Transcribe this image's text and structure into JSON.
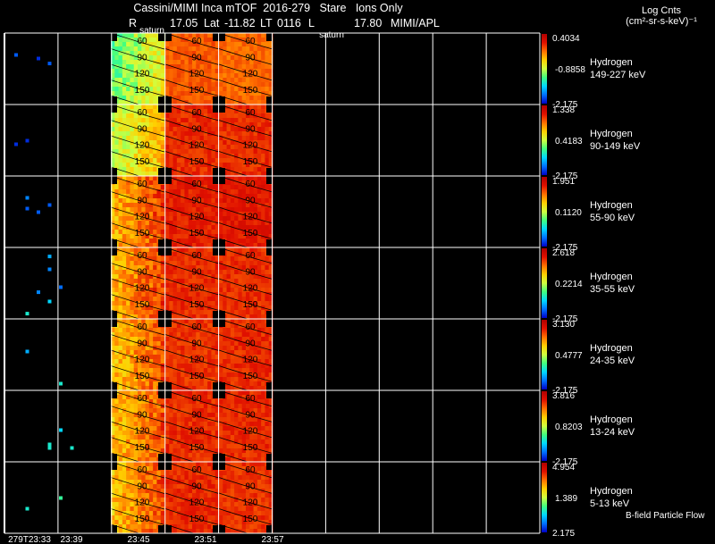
{
  "header": {
    "title": "Cassini/MIMI Inca mTOF  2016-279   Stare   Ions Only",
    "r_label": "R",
    "r_value": "17.05",
    "lat_label": "Lat",
    "lat_value": "-11.82",
    "lt_label": "LT",
    "lt_value": "0116",
    "l_label": "L",
    "l_value": "17.80",
    "org": "MIMI/APL",
    "planet_label": "saturn"
  },
  "colorbar_title": {
    "line1": "Log Cnts",
    "line2": "(cm²-sr-s-keV)⁻¹"
  },
  "footer_note": "B-field Particle Flow",
  "colors": {
    "background": "#000000",
    "grid": "#ffffff",
    "colormap": [
      "#0000c8",
      "#0070ff",
      "#00d8ff",
      "#40ff80",
      "#d0ff40",
      "#ffd000",
      "#ff7000",
      "#e01000",
      "#b00000"
    ]
  },
  "chart_data": {
    "type": "heatmap",
    "x_ticks": [
      "279T23:33",
      "23:39",
      "23:45",
      "23:51",
      "23:57"
    ],
    "map_contour_labels": [
      "60",
      "90",
      "120",
      "150"
    ],
    "rows": [
      {
        "species": "Hydrogen",
        "energy": "149-227 keV",
        "cmax": "0.4034",
        "cmid": "-0.8858",
        "cmin": "-2.175"
      },
      {
        "species": "Hydrogen",
        "energy": "90-149 keV",
        "cmax": "1.338",
        "cmid": "0.4183",
        "cmin": "-2.175"
      },
      {
        "species": "Hydrogen",
        "energy": "55-90 keV",
        "cmax": "1.951",
        "cmid": "0.1120",
        "cmin": "-2.175"
      },
      {
        "species": "Hydrogen",
        "energy": "35-55 keV",
        "cmax": "2.618",
        "cmid": "0.2214",
        "cmin": "-2.175"
      },
      {
        "species": "Hydrogen",
        "energy": "24-35 keV",
        "cmax": "3.130",
        "cmid": "0.4777",
        "cmin": "-2.175"
      },
      {
        "species": "Hydrogen",
        "energy": "13-24 keV",
        "cmax": "3.816",
        "cmid": "0.8203",
        "cmin": "-2.175"
      },
      {
        "species": "Hydrogen",
        "energy": "5-13 keV",
        "cmax": "4.954",
        "cmid": "1.389",
        "cmin": "2.175"
      }
    ],
    "panel_levels": [
      [
        0.48,
        0.78,
        0.76
      ],
      [
        0.58,
        0.84,
        0.84
      ],
      [
        0.74,
        0.86,
        0.87
      ],
      [
        0.74,
        0.84,
        0.84
      ],
      [
        0.72,
        0.83,
        0.84
      ],
      [
        0.72,
        0.84,
        0.84
      ],
      [
        0.72,
        0.84,
        0.83
      ]
    ],
    "scatter_pixels": [
      [
        {
          "x": "23:34",
          "y": 0.3,
          "c": 0.1
        },
        {
          "x": "23:36",
          "y": 0.35,
          "c": 0.05
        },
        {
          "x": "23:37",
          "y": 0.42,
          "c": 0.1
        }
      ],
      [
        {
          "x": "23:34",
          "y": 0.55,
          "c": 0.05
        },
        {
          "x": "23:35",
          "y": 0.5,
          "c": 0.05
        }
      ],
      [
        {
          "x": "23:35",
          "y": 0.3,
          "c": 0.15
        },
        {
          "x": "23:35",
          "y": 0.45,
          "c": 0.1
        },
        {
          "x": "23:36",
          "y": 0.5,
          "c": 0.1
        },
        {
          "x": "23:37",
          "y": 0.4,
          "c": 0.1
        }
      ],
      [
        {
          "x": "23:37",
          "y": 0.12,
          "c": 0.2
        },
        {
          "x": "23:37",
          "y": 0.3,
          "c": 0.15
        },
        {
          "x": "23:38",
          "y": 0.55,
          "c": 0.12
        },
        {
          "x": "23:36",
          "y": 0.62,
          "c": 0.15
        },
        {
          "x": "23:37",
          "y": 0.75,
          "c": 0.25
        },
        {
          "x": "23:35",
          "y": 0.92,
          "c": 0.3
        }
      ],
      [
        {
          "x": "23:35",
          "y": 0.45,
          "c": 0.2
        },
        {
          "x": "23:38",
          "y": 0.9,
          "c": 0.3
        }
      ],
      [
        {
          "x": "23:38",
          "y": 0.55,
          "c": 0.25
        },
        {
          "x": "23:37",
          "y": 0.75,
          "c": 0.3
        },
        {
          "x": "23:37",
          "y": 0.8,
          "c": 0.3
        },
        {
          "x": "23:39",
          "y": 0.8,
          "c": 0.3
        }
      ],
      [
        {
          "x": "23:38",
          "y": 0.5,
          "c": 0.35
        },
        {
          "x": "23:35",
          "y": 0.65,
          "c": 0.3
        }
      ]
    ]
  }
}
